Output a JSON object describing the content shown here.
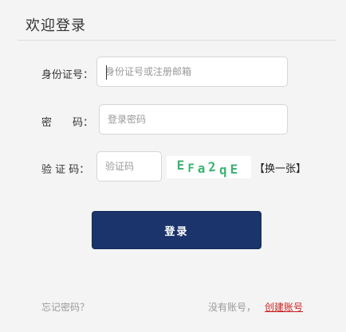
{
  "form": {
    "title": "欢迎登录",
    "id_label": "身份证号：",
    "id_placeholder": "身份证号或注册邮箱",
    "password_label": "密　　码：",
    "password_placeholder": "登录密码",
    "captcha_label": "验 证 码：",
    "captcha_placeholder": "验证码",
    "captcha_chars": [
      "E",
      "F",
      "a",
      "2",
      "q",
      "E"
    ],
    "captcha_color": "#3cb371",
    "refresh_label": "【换一张】",
    "login_button": "登录",
    "login_button_color": "#1b346b"
  },
  "footer": {
    "forgot_label": "忘记密码？",
    "no_account_label": "没有账号，",
    "create_account_label": "创建账号",
    "link_color": "#cc2222"
  }
}
